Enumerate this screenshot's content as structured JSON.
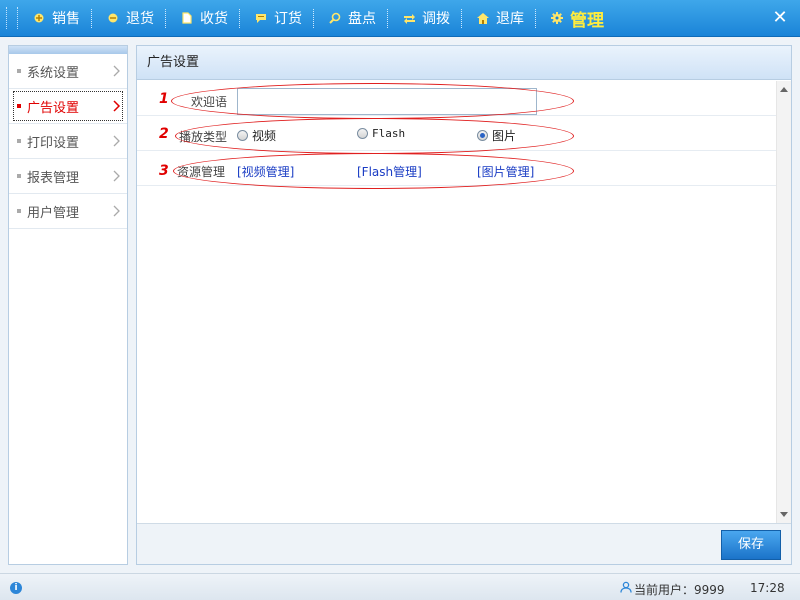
{
  "nav": {
    "items": [
      {
        "label": "销售",
        "icon": "plus-circle-icon"
      },
      {
        "label": "退货",
        "icon": "minus-circle-icon"
      },
      {
        "label": "收货",
        "icon": "document-icon"
      },
      {
        "label": "订货",
        "icon": "chat-bubble-icon"
      },
      {
        "label": "盘点",
        "icon": "magnifier-icon"
      },
      {
        "label": "调拨",
        "icon": "swap-arrows-icon"
      },
      {
        "label": "退库",
        "icon": "home-icon"
      },
      {
        "label": "管理",
        "icon": "gear-icon"
      }
    ],
    "close_label": "✕",
    "active_color": "#ffec3d"
  },
  "sidebar": {
    "items": [
      {
        "label": "系统设置"
      },
      {
        "label": "广告设置"
      },
      {
        "label": "打印设置"
      },
      {
        "label": "报表管理"
      },
      {
        "label": "用户管理"
      }
    ],
    "active_color": "#e00000"
  },
  "main": {
    "title": "广告设置",
    "rows": [
      {
        "num": "1",
        "label": "欢迎语",
        "input_value": ""
      },
      {
        "num": "2",
        "label": "播放类型",
        "options": [
          {
            "label": "视频",
            "checked": false
          },
          {
            "label": "Flash",
            "checked": false
          },
          {
            "label": "图片",
            "checked": true
          }
        ]
      },
      {
        "num": "3",
        "label": "资源管理",
        "links": [
          {
            "label": "[视频管理]"
          },
          {
            "label": "[Flash管理]"
          },
          {
            "label": "[图片管理]"
          }
        ]
      }
    ],
    "save_label": "保存"
  },
  "status": {
    "user_text": "当前用户：9999",
    "time": "17:28"
  },
  "colors": {
    "topbar": "#1a84d8",
    "annotation": "#e02020",
    "link": "#1a3cc4"
  }
}
